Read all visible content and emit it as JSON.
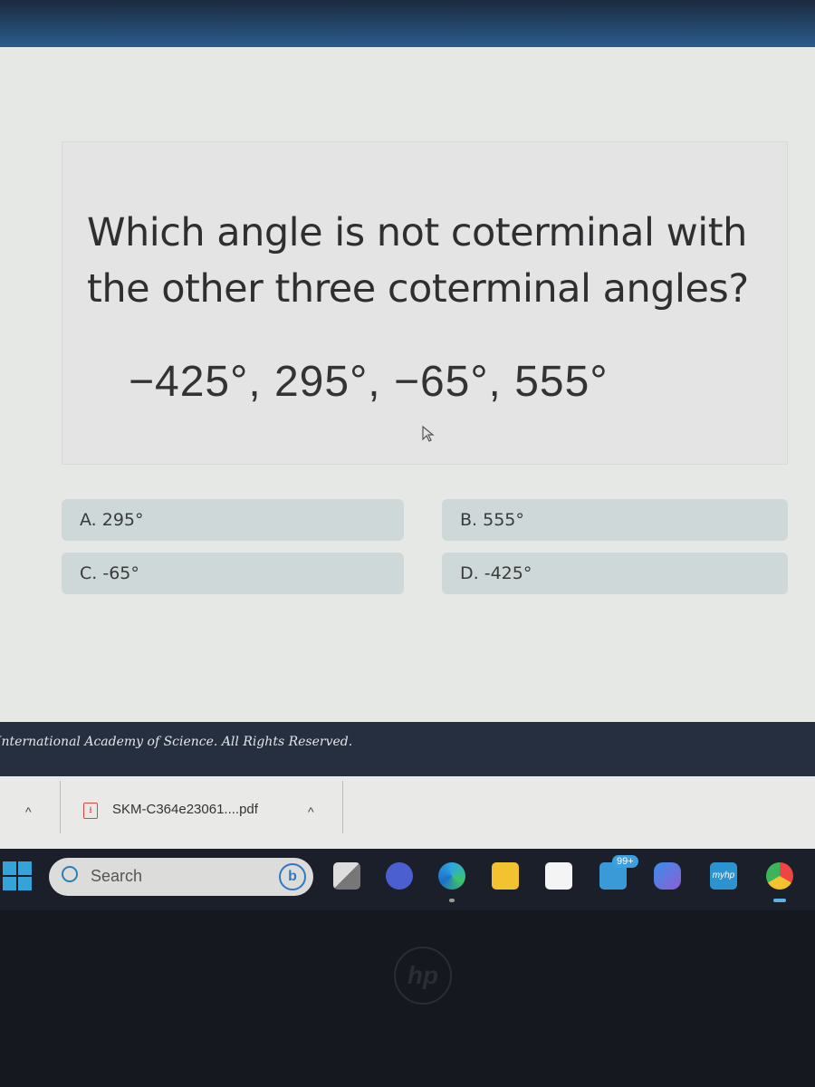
{
  "question": {
    "text": "Which angle is not coterminal with the other three coterminal angles?",
    "angles": "−425°, 295°, −65°, 555°"
  },
  "choices": [
    {
      "label": "A. 295°"
    },
    {
      "label": "B. 555°"
    },
    {
      "label": "C. -65°"
    },
    {
      "label": "D. -425°"
    }
  ],
  "footer": {
    "copyright": "International Academy of Science. All Rights Reserved."
  },
  "downloads": {
    "file_name": "SKM-C364e23061....pdf",
    "expand_chevron": "^",
    "file_chevron": "^",
    "pdf_icon_glyph": "⭳"
  },
  "taskbar": {
    "search_label": "Search",
    "bing_glyph": "b",
    "mail_badge": "99+",
    "icons": [
      "start-icon",
      "search-icon",
      "bing-icon",
      "task-view-icon",
      "teams-meet-icon",
      "edge-icon",
      "file-explorer-icon",
      "store-icon",
      "mail-icon",
      "copilot-icon",
      "myhp-icon",
      "chrome-icon"
    ],
    "myhp_label": "myhp"
  },
  "device": {
    "logo": "hp"
  },
  "colors": {
    "accent": "#35a3d8",
    "choice_bg": "#cfd8d8",
    "footer_bg": "#252f3f"
  }
}
